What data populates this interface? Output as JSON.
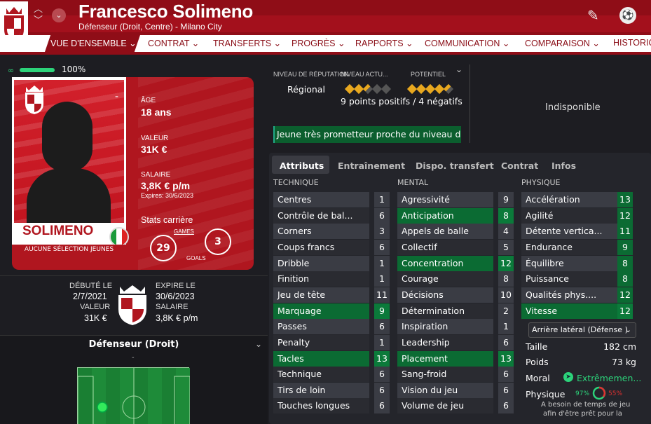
{
  "header": {
    "player_name": "Francesco Solimeno",
    "subtitle": "Défenseur (Droit, Centre) - Milano City"
  },
  "nav": {
    "items": [
      {
        "label": "VUE D'ENSEMBLE",
        "active": true
      },
      {
        "label": "CONTRAT"
      },
      {
        "label": "TRANSFERTS"
      },
      {
        "label": "PROGRÈS"
      },
      {
        "label": "RAPPORTS"
      },
      {
        "label": "COMMUNICATION"
      },
      {
        "label": "COMPARAISON"
      },
      {
        "label": "HISTORIQ"
      }
    ]
  },
  "condition": {
    "percent": "100%",
    "level": 1.0
  },
  "card": {
    "surname": "SOLIMENO",
    "no_selection": "AUCUNE SÉLECTION JEUNES",
    "dash": "-",
    "age_label": "ÂGE",
    "age_value": "18 ans",
    "value_label": "VALEUR",
    "value_value": "31K €",
    "salary_label": "SALAIRE",
    "salary_value": "3,8K € p/m",
    "expires": "Expires: 30/6/2023",
    "stats_label": "Stats carrière",
    "games_label": "GAMES",
    "games_value": "29",
    "goals_label": "GOALS",
    "goals_value": "3"
  },
  "contract_summary": {
    "debut_label": "DÉBUTÉ LE",
    "debut_value": "2/7/2021",
    "expire_label": "EXPIRE LE",
    "expire_value": "30/6/2023",
    "value_label": "VALEUR",
    "value_value": "31K €",
    "salary_label": "SALAIRE",
    "salary_value": "3,8K € p/m"
  },
  "position": {
    "title": "Défenseur (Droit)",
    "sub": "-"
  },
  "reputation": {
    "rep_label": "NIVEAU DE RÉPUTATION",
    "current_label": "NIVEAU ACTU...",
    "potential_label": "POTENTIEL",
    "region": "Régional",
    "current_stars": 2.5,
    "potential_stars": 4.5,
    "points": "9 points positifs / 4 négatifs",
    "message": "Jeune très prometteur proche du niveau d..."
  },
  "unavailable": "Indisponible",
  "tabs": [
    "Attributs",
    "Entraînement",
    "Dispo. transfert",
    "Contrat",
    "Infos"
  ],
  "attributes": {
    "technique_title": "TECHNIQUE",
    "mental_title": "MENTAL",
    "physique_title": "PHYSIQUE",
    "technique": [
      {
        "name": "Centres",
        "value": "1",
        "hl": false
      },
      {
        "name": "Contrôle de bal...",
        "value": "6",
        "hl": false
      },
      {
        "name": "Corners",
        "value": "3",
        "hl": false
      },
      {
        "name": "Coups francs",
        "value": "6",
        "hl": false
      },
      {
        "name": "Dribble",
        "value": "1",
        "hl": false
      },
      {
        "name": "Finition",
        "value": "1",
        "hl": false
      },
      {
        "name": "Jeu de tête",
        "value": "11",
        "hl": false
      },
      {
        "name": "Marquage",
        "value": "9",
        "hl": true
      },
      {
        "name": "Passes",
        "value": "6",
        "hl": false
      },
      {
        "name": "Penalty",
        "value": "1",
        "hl": false
      },
      {
        "name": "Tacles",
        "value": "13",
        "hl": true
      },
      {
        "name": "Technique",
        "value": "6",
        "hl": false
      },
      {
        "name": "Tirs de loin",
        "value": "6",
        "hl": false
      },
      {
        "name": "Touches longues",
        "value": "6",
        "hl": false
      }
    ],
    "mental": [
      {
        "name": "Agressivité",
        "value": "9",
        "hl": false
      },
      {
        "name": "Anticipation",
        "value": "8",
        "hl": true
      },
      {
        "name": "Appels de balle",
        "value": "4",
        "hl": false
      },
      {
        "name": "Collectif",
        "value": "5",
        "hl": false
      },
      {
        "name": "Concentration",
        "value": "12",
        "hl": true
      },
      {
        "name": "Courage",
        "value": "8",
        "hl": false
      },
      {
        "name": "Décisions",
        "value": "10",
        "hl": false
      },
      {
        "name": "Détermination",
        "value": "2",
        "hl": false
      },
      {
        "name": "Inspiration",
        "value": "1",
        "hl": false
      },
      {
        "name": "Leadership",
        "value": "6",
        "hl": false
      },
      {
        "name": "Placement",
        "value": "13",
        "hl": true
      },
      {
        "name": "Sang-froid",
        "value": "6",
        "hl": false
      },
      {
        "name": "Vision du jeu",
        "value": "6",
        "hl": false
      },
      {
        "name": "Volume de jeu",
        "value": "6",
        "hl": false
      }
    ],
    "physique": [
      {
        "name": "Accélération",
        "value": "13",
        "hl": false
      },
      {
        "name": "Agilité",
        "value": "12",
        "hl": false
      },
      {
        "name": "Détente vertica...",
        "value": "11",
        "hl": false
      },
      {
        "name": "Endurance",
        "value": "9",
        "hl": false
      },
      {
        "name": "Équilibre",
        "value": "8",
        "hl": false
      },
      {
        "name": "Puissance",
        "value": "8",
        "hl": false
      },
      {
        "name": "Qualités phys....",
        "value": "12",
        "hl": false
      },
      {
        "name": "Vitesse",
        "value": "12",
        "hl": true
      }
    ]
  },
  "physical_info": {
    "role": "Arrière latéral (Défense )",
    "height_label": "Taille",
    "height_value": "182 cm",
    "weight_label": "Poids",
    "weight_value": "73 kg",
    "morale_label": "Moral",
    "morale_value": "Extrêmemen...",
    "fitness_label": "Physique",
    "fitness_a": "97%",
    "fitness_b": "55%",
    "note1": "A besoin de temps de jeu",
    "note2": "afin d'être prêt pour la"
  },
  "colors": {
    "brand_red": "#8f0d17",
    "green": "#0b6b33",
    "bg": "#1d1d22"
  }
}
